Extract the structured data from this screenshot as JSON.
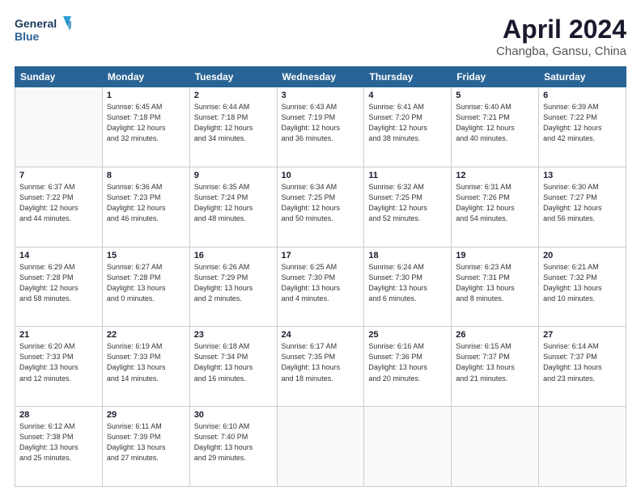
{
  "header": {
    "logo_line1": "General",
    "logo_line2": "Blue",
    "title": "April 2024",
    "subtitle": "Changba, Gansu, China"
  },
  "days_of_week": [
    "Sunday",
    "Monday",
    "Tuesday",
    "Wednesday",
    "Thursday",
    "Friday",
    "Saturday"
  ],
  "weeks": [
    [
      {
        "day": "",
        "info": ""
      },
      {
        "day": "1",
        "info": "Sunrise: 6:45 AM\nSunset: 7:18 PM\nDaylight: 12 hours\nand 32 minutes."
      },
      {
        "day": "2",
        "info": "Sunrise: 6:44 AM\nSunset: 7:18 PM\nDaylight: 12 hours\nand 34 minutes."
      },
      {
        "day": "3",
        "info": "Sunrise: 6:43 AM\nSunset: 7:19 PM\nDaylight: 12 hours\nand 36 minutes."
      },
      {
        "day": "4",
        "info": "Sunrise: 6:41 AM\nSunset: 7:20 PM\nDaylight: 12 hours\nand 38 minutes."
      },
      {
        "day": "5",
        "info": "Sunrise: 6:40 AM\nSunset: 7:21 PM\nDaylight: 12 hours\nand 40 minutes."
      },
      {
        "day": "6",
        "info": "Sunrise: 6:39 AM\nSunset: 7:22 PM\nDaylight: 12 hours\nand 42 minutes."
      }
    ],
    [
      {
        "day": "7",
        "info": "Sunrise: 6:37 AM\nSunset: 7:22 PM\nDaylight: 12 hours\nand 44 minutes."
      },
      {
        "day": "8",
        "info": "Sunrise: 6:36 AM\nSunset: 7:23 PM\nDaylight: 12 hours\nand 46 minutes."
      },
      {
        "day": "9",
        "info": "Sunrise: 6:35 AM\nSunset: 7:24 PM\nDaylight: 12 hours\nand 48 minutes."
      },
      {
        "day": "10",
        "info": "Sunrise: 6:34 AM\nSunset: 7:25 PM\nDaylight: 12 hours\nand 50 minutes."
      },
      {
        "day": "11",
        "info": "Sunrise: 6:32 AM\nSunset: 7:25 PM\nDaylight: 12 hours\nand 52 minutes."
      },
      {
        "day": "12",
        "info": "Sunrise: 6:31 AM\nSunset: 7:26 PM\nDaylight: 12 hours\nand 54 minutes."
      },
      {
        "day": "13",
        "info": "Sunrise: 6:30 AM\nSunset: 7:27 PM\nDaylight: 12 hours\nand 56 minutes."
      }
    ],
    [
      {
        "day": "14",
        "info": "Sunrise: 6:29 AM\nSunset: 7:28 PM\nDaylight: 12 hours\nand 58 minutes."
      },
      {
        "day": "15",
        "info": "Sunrise: 6:27 AM\nSunset: 7:28 PM\nDaylight: 13 hours\nand 0 minutes."
      },
      {
        "day": "16",
        "info": "Sunrise: 6:26 AM\nSunset: 7:29 PM\nDaylight: 13 hours\nand 2 minutes."
      },
      {
        "day": "17",
        "info": "Sunrise: 6:25 AM\nSunset: 7:30 PM\nDaylight: 13 hours\nand 4 minutes."
      },
      {
        "day": "18",
        "info": "Sunrise: 6:24 AM\nSunset: 7:30 PM\nDaylight: 13 hours\nand 6 minutes."
      },
      {
        "day": "19",
        "info": "Sunrise: 6:23 AM\nSunset: 7:31 PM\nDaylight: 13 hours\nand 8 minutes."
      },
      {
        "day": "20",
        "info": "Sunrise: 6:21 AM\nSunset: 7:32 PM\nDaylight: 13 hours\nand 10 minutes."
      }
    ],
    [
      {
        "day": "21",
        "info": "Sunrise: 6:20 AM\nSunset: 7:33 PM\nDaylight: 13 hours\nand 12 minutes."
      },
      {
        "day": "22",
        "info": "Sunrise: 6:19 AM\nSunset: 7:33 PM\nDaylight: 13 hours\nand 14 minutes."
      },
      {
        "day": "23",
        "info": "Sunrise: 6:18 AM\nSunset: 7:34 PM\nDaylight: 13 hours\nand 16 minutes."
      },
      {
        "day": "24",
        "info": "Sunrise: 6:17 AM\nSunset: 7:35 PM\nDaylight: 13 hours\nand 18 minutes."
      },
      {
        "day": "25",
        "info": "Sunrise: 6:16 AM\nSunset: 7:36 PM\nDaylight: 13 hours\nand 20 minutes."
      },
      {
        "day": "26",
        "info": "Sunrise: 6:15 AM\nSunset: 7:37 PM\nDaylight: 13 hours\nand 21 minutes."
      },
      {
        "day": "27",
        "info": "Sunrise: 6:14 AM\nSunset: 7:37 PM\nDaylight: 13 hours\nand 23 minutes."
      }
    ],
    [
      {
        "day": "28",
        "info": "Sunrise: 6:12 AM\nSunset: 7:38 PM\nDaylight: 13 hours\nand 25 minutes."
      },
      {
        "day": "29",
        "info": "Sunrise: 6:11 AM\nSunset: 7:39 PM\nDaylight: 13 hours\nand 27 minutes."
      },
      {
        "day": "30",
        "info": "Sunrise: 6:10 AM\nSunset: 7:40 PM\nDaylight: 13 hours\nand 29 minutes."
      },
      {
        "day": "",
        "info": ""
      },
      {
        "day": "",
        "info": ""
      },
      {
        "day": "",
        "info": ""
      },
      {
        "day": "",
        "info": ""
      }
    ]
  ]
}
